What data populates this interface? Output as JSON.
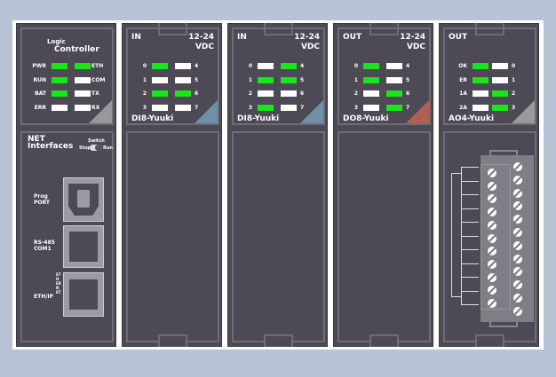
{
  "colors": {
    "background": "#b9c3d6",
    "module": "#4d4a55",
    "led_on": "#19e619",
    "led_off": "#ffffff"
  },
  "controller": {
    "title_small": "Logic",
    "title": "Controller",
    "leds": [
      {
        "left": "PWR",
        "left_on": true,
        "right": "ETH",
        "right_on": true
      },
      {
        "left": "RUN",
        "left_on": true,
        "right": "COM",
        "right_on": false
      },
      {
        "left": "BAT",
        "left_on": true,
        "right": "TX",
        "right_on": false
      },
      {
        "left": "ERR",
        "left_on": false,
        "right": "RX",
        "right_on": false
      }
    ],
    "corner_color": "#9a9a9a",
    "net_title_1": "NET",
    "net_title_2": "Interfaces",
    "switch_label": "Switch",
    "switch_stop": "Stop",
    "switch_run": "Run",
    "ports": [
      {
        "label1": "Prog",
        "label2": "PORT",
        "icon": "usb-b-port-icon"
      },
      {
        "label1": "RS-485",
        "label2": "COM1",
        "icon": "rj45-port-icon"
      },
      {
        "label1": "ETH/IP",
        "label2": "",
        "icon": "rj45-port-icon"
      }
    ],
    "ethernet_vertical": "ETHERNET"
  },
  "modules": [
    {
      "type": "IN",
      "voltage1": "12-24",
      "voltage2": "VDC",
      "name": "DI8-Yuuki",
      "corner_color": "#6f90a8",
      "leds": [
        {
          "left": "0",
          "left_on": true,
          "right": "4",
          "right_on": false
        },
        {
          "left": "1",
          "left_on": false,
          "right": "5",
          "right_on": false
        },
        {
          "left": "2",
          "left_on": true,
          "right": "6",
          "right_on": true
        },
        {
          "left": "3",
          "left_on": false,
          "right": "7",
          "right_on": false
        }
      ]
    },
    {
      "type": "IN",
      "voltage1": "12-24",
      "voltage2": "VDC",
      "name": "DI8-Yuuki",
      "corner_color": "#6f90a8",
      "leds": [
        {
          "left": "0",
          "left_on": false,
          "right": "4",
          "right_on": true
        },
        {
          "left": "1",
          "left_on": true,
          "right": "5",
          "right_on": true
        },
        {
          "left": "2",
          "left_on": false,
          "right": "6",
          "right_on": false
        },
        {
          "left": "3",
          "left_on": true,
          "right": "7",
          "right_on": false
        }
      ]
    },
    {
      "type": "OUT",
      "voltage1": "12-24",
      "voltage2": "VDC",
      "name": "DO8-Yuuki",
      "corner_color": "#b0604f",
      "leds": [
        {
          "left": "0",
          "left_on": true,
          "right": "4",
          "right_on": false
        },
        {
          "left": "1",
          "left_on": true,
          "right": "5",
          "right_on": false
        },
        {
          "left": "2",
          "left_on": false,
          "right": "6",
          "right_on": true
        },
        {
          "left": "3",
          "left_on": false,
          "right": "7",
          "right_on": true
        }
      ]
    },
    {
      "type": "OUT",
      "voltage1": "",
      "voltage2": "",
      "name": "AO4-Yuuki",
      "corner_color": "#9a9a9a",
      "leds": [
        {
          "left": "OK",
          "left_on": true,
          "right": "0",
          "right_on": false
        },
        {
          "left": "ER",
          "left_on": true,
          "right": "1",
          "right_on": false
        },
        {
          "left": "1A",
          "left_on": false,
          "right": "2",
          "right_on": true
        },
        {
          "left": "2A",
          "left_on": false,
          "right": "3",
          "right_on": true
        }
      ]
    }
  ]
}
